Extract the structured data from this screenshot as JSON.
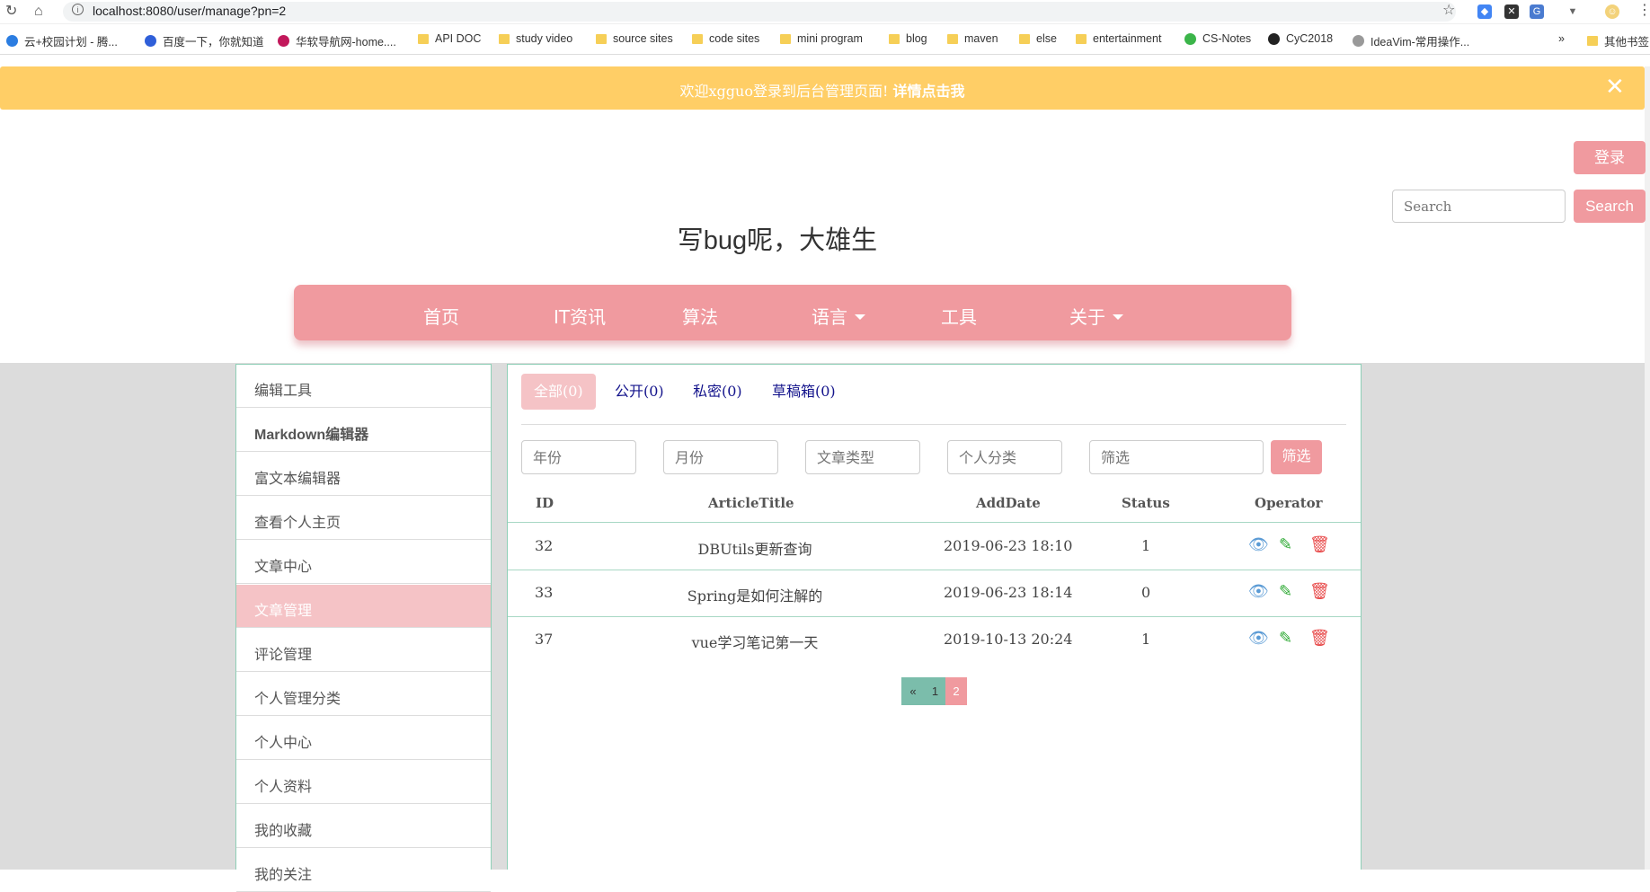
{
  "browser": {
    "url": "localhost:8080/user/manage?pn=2",
    "bookmarks": [
      "云+校园计划 - 腾...",
      "百度一下，你就知道",
      "华软导航网-home....",
      "API DOC",
      "study video",
      "source sites",
      "code sites",
      "mini program",
      "blog",
      "maven",
      "else",
      "entertainment",
      "CS-Notes",
      "CyC2018",
      "IdeaVim-常用操作...",
      "»",
      "其他书签"
    ]
  },
  "banner": {
    "text": "欢迎xgguo登录到后台管理页面! ",
    "link": "详情点击我",
    "close": "✕"
  },
  "header": {
    "login": "登录",
    "search_placeholder": "Search",
    "search_button": "Search",
    "title": "写bug呢，大雄生"
  },
  "nav": [
    "首页",
    "IT资讯",
    "算法",
    "语言",
    "工具",
    "关于"
  ],
  "sidebar": [
    "编辑工具",
    "Markdown编辑器",
    "富文本编辑器",
    "查看个人主页",
    "文章中心",
    "文章管理",
    "评论管理",
    "个人管理分类",
    "个人中心",
    "个人资料",
    "我的收藏",
    "我的关注"
  ],
  "sidebar_active": "文章管理",
  "tabs": [
    "全部(0)",
    "公开(0)",
    "私密(0)",
    "草稿箱(0)"
  ],
  "filters": {
    "year": "年份",
    "month": "月份",
    "type": "文章类型",
    "category": "个人分类",
    "keyword": "筛选",
    "button": "筛选"
  },
  "table": {
    "headers": [
      "ID",
      "ArticleTitle",
      "AddDate",
      "Status",
      "Operator"
    ],
    "rows": [
      {
        "id": "32",
        "title": "DBUtils更新查询",
        "date": "2019-06-23 18:10",
        "status": "1"
      },
      {
        "id": "33",
        "title": "Spring是如何注解的",
        "date": "2019-06-23 18:14",
        "status": "0"
      },
      {
        "id": "37",
        "title": "vue学习笔记第一天",
        "date": "2019-10-13 20:24",
        "status": "1"
      }
    ]
  },
  "pagination": [
    "«",
    "1",
    "2"
  ],
  "colors": {
    "accent": "#f09a9f",
    "banner": "#ffce66",
    "border": "#8fcfb7",
    "view": "#5b9bd5",
    "edit": "#2aa830",
    "delete": "#e84a4a"
  }
}
